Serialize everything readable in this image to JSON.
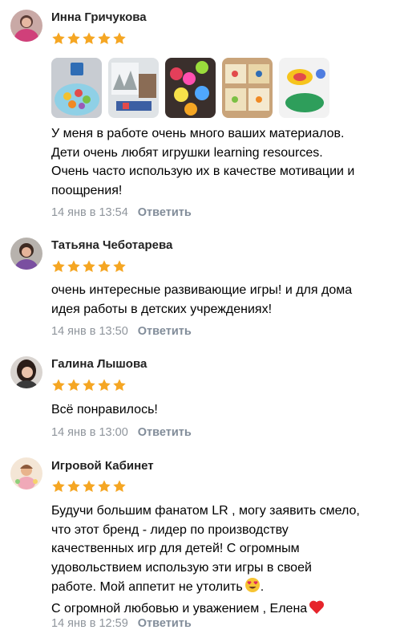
{
  "accent_star": "#f5a623",
  "reply_label": "Ответить",
  "reviews": [
    {
      "name": "Инна Гричукова",
      "stars": 5,
      "photos": [
        "photo-toys-bowl",
        "photo-classroom",
        "photo-light-buttons",
        "photo-game-boards",
        "photo-colorful-toys"
      ],
      "lines": [
        "У меня в работе очень много ваших материалов.",
        "Дети очень любят игрушки learning resources.",
        "Очень часто использую их в качестве мотивации и",
        "поощрения!"
      ],
      "time": "14 янв в 13:54"
    },
    {
      "name": "Татьяна Чеботарева",
      "stars": 5,
      "lines": [
        "очень интересные развивающие игры! и для дома",
        "идея работы в детских учреждениях!"
      ],
      "time": "14 янв в 13:50"
    },
    {
      "name": "Галина Лышова",
      "stars": 5,
      "lines": [
        "Всё понравилось!"
      ],
      "time": "14 янв в 13:00"
    },
    {
      "name": "Игровой Кабинет",
      "stars": 5,
      "lines": [
        "Будучи большим фанатом LR , могу заявить смело,",
        "что этот бренд - лидер по производству",
        "качественных игр для детей! С огромным",
        "удовольствием использую эти игры в своей",
        "работе. Мой аппетит не утолить",
        "С огромной любовью и уважением , Елена"
      ],
      "emojis": [
        "heart-eyes-emoji",
        "red-heart-emoji"
      ],
      "time": "14 янв в 12:59"
    }
  ]
}
